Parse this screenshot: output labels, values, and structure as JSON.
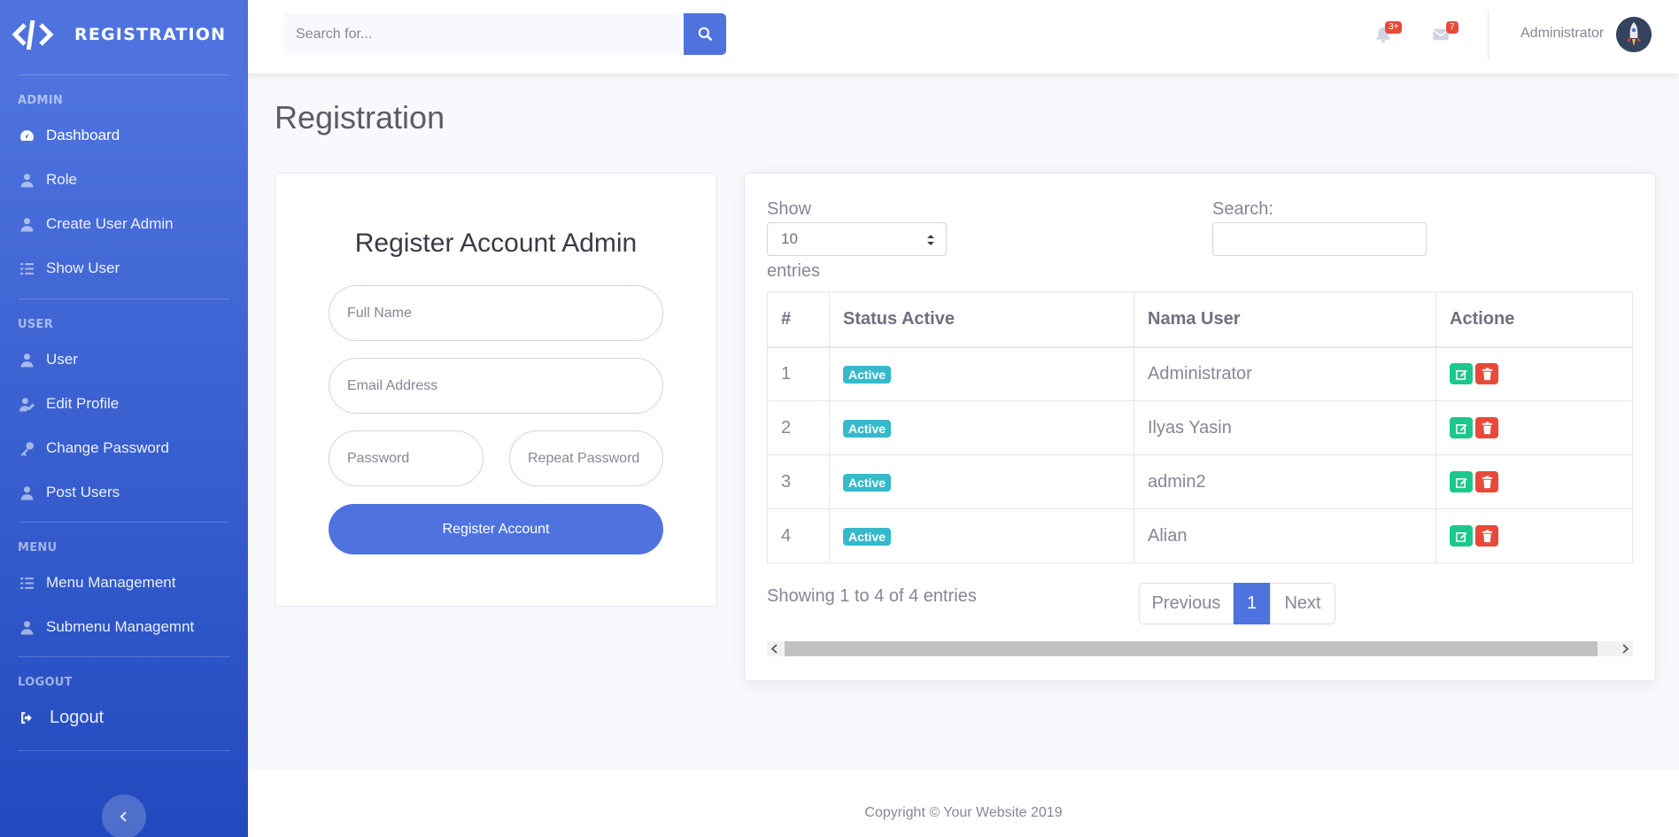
{
  "brand": {
    "name": "REGISTRATION"
  },
  "sidebar": {
    "sections": [
      {
        "heading": "ADMIN",
        "items": [
          {
            "label": "Dashboard",
            "icon": "tachometer-icon",
            "active": true
          },
          {
            "label": "Role",
            "icon": "user-icon"
          },
          {
            "label": "Create User Admin",
            "icon": "user-icon"
          },
          {
            "label": "Show User",
            "icon": "list-icon"
          }
        ]
      },
      {
        "heading": "USER",
        "items": [
          {
            "label": "User",
            "icon": "user-icon"
          },
          {
            "label": "Edit Profile",
            "icon": "user-edit-icon"
          },
          {
            "label": "Change Password",
            "icon": "key-icon"
          },
          {
            "label": "Post Users",
            "icon": "user-icon"
          }
        ]
      },
      {
        "heading": "MENU",
        "items": [
          {
            "label": "Menu Management",
            "icon": "list-icon"
          },
          {
            "label": "Submenu Managemnt",
            "icon": "user-icon"
          }
        ]
      },
      {
        "heading": "LOGOUT",
        "items": [
          {
            "label": "Logout",
            "icon": "sign-out-icon"
          }
        ]
      }
    ]
  },
  "topbar": {
    "search_placeholder": "Search for...",
    "alerts_badge": "3+",
    "messages_badge": "7",
    "user_name": "Administrator"
  },
  "page": {
    "title": "Registration"
  },
  "register_form": {
    "title": "Register Account Admin",
    "full_name_placeholder": "Full Name",
    "email_placeholder": "Email Address",
    "password_placeholder": "Password",
    "repeat_password_placeholder": "Repeat Password",
    "submit_label": "Register Account"
  },
  "users_table": {
    "show_label": "Show",
    "page_length": "10",
    "entries_label": "entries",
    "search_label": "Search:",
    "columns": [
      "#",
      "Status Active",
      "Nama User",
      "Actione"
    ],
    "rows": [
      {
        "no": "1",
        "status": "Active",
        "name": "Administrator"
      },
      {
        "no": "2",
        "status": "Active",
        "name": "Ilyas Yasin"
      },
      {
        "no": "3",
        "status": "Active",
        "name": "admin2"
      },
      {
        "no": "4",
        "status": "Active",
        "name": "Alian"
      }
    ],
    "info": "Showing 1 to 4 of 4 entries",
    "pagination": {
      "previous": "Previous",
      "current": "1",
      "next": "Next"
    }
  },
  "footer": {
    "copyright": "Copyright © Your Website 2019"
  },
  "colors": {
    "primary": "#4e73df",
    "info": "#36b9cc",
    "success": "#1cc88a",
    "danger": "#e74a3b"
  }
}
